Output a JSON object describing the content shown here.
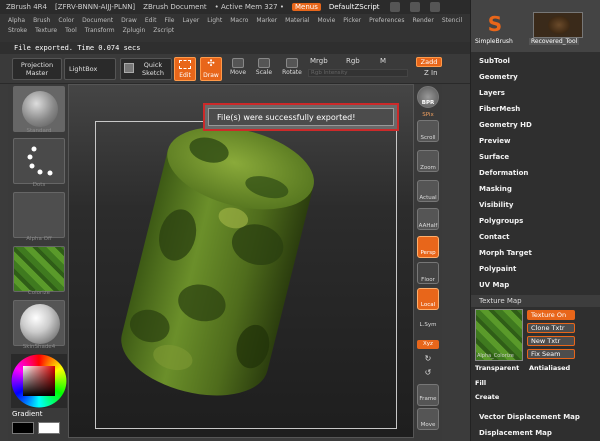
{
  "titlebar": {
    "app": "ZBrush 4R4",
    "build": "[ZFRV-BNNN-AIJJ-PLNN]",
    "doc": "ZBrush Document",
    "mem": "• Active Mem 327 •",
    "menus": "Menus",
    "script": "DefaultZScript"
  },
  "menubar": {
    "items": [
      "Alpha",
      "Brush",
      "Color",
      "Document",
      "Draw",
      "Edit",
      "File",
      "Layer",
      "Light",
      "Macro",
      "Marker",
      "Material",
      "Movie",
      "Picker",
      "Preferences",
      "Render",
      "Stencil",
      "Stroke",
      "Texture",
      "Tool",
      "Transform",
      "Zplugin",
      "Zscript"
    ]
  },
  "status": "File exported. Time 0.074 secs",
  "toolbar": {
    "projection_master": "Projection\nMaster",
    "lightbox": "LightBox",
    "quick_sketch": "Quick\nSketch",
    "edit": "Edit",
    "draw": "Draw",
    "move": "Move",
    "scale": "Scale",
    "rotate": "Rotate",
    "mrgb": "Mrgb",
    "rgb": "Rgb",
    "m": "M",
    "rgb_intensity": "Rgb Intensity",
    "zadd": "Zadd",
    "zint": "Z In"
  },
  "leftshelf": {
    "standard": "Standard",
    "dots": "Dots",
    "alpha_off": "Alpha Off",
    "colorize": "Colorize",
    "skinshade": "SkinShade4",
    "gradient": "Gradient"
  },
  "toast": "File(s) were successfully exported!",
  "rightcol": {
    "bpr": "BPR",
    "spix": "SPix",
    "scroll": "Scroll",
    "zoom": "Zoom",
    "actual": "Actual",
    "aahalf": "AAHalf",
    "persp": "Persp",
    "floor": "Floor",
    "local": "Local",
    "lsym": "L.Sym",
    "xyz": "Xyz",
    "frame": "Frame",
    "move": "Move"
  },
  "palette": {
    "simple_brush": "SimpleBrush",
    "recovered_tool": "Recovered_Tool",
    "items": [
      "SubTool",
      "Geometry",
      "Layers",
      "FiberMesh",
      "Geometry HD",
      "Preview",
      "Surface",
      "Deformation",
      "Masking",
      "Visibility",
      "Polygroups",
      "Contact",
      "Morph Target",
      "Polypaint",
      "UV Map"
    ],
    "texture_map_header": "Texture Map",
    "texture_on": "Texture On",
    "clone_txtr": "Clone Txtr",
    "new_txtr": "New Txtr",
    "fix_seam": "Fix Seam",
    "thumb_label": "Alpha_Colorize",
    "transparent": "Transparent",
    "antialiased": "Antialiased",
    "fill": "Fill",
    "create": "Create",
    "vector_displacement": "Vector Displacement Map",
    "displacement": "Displacement Map"
  }
}
